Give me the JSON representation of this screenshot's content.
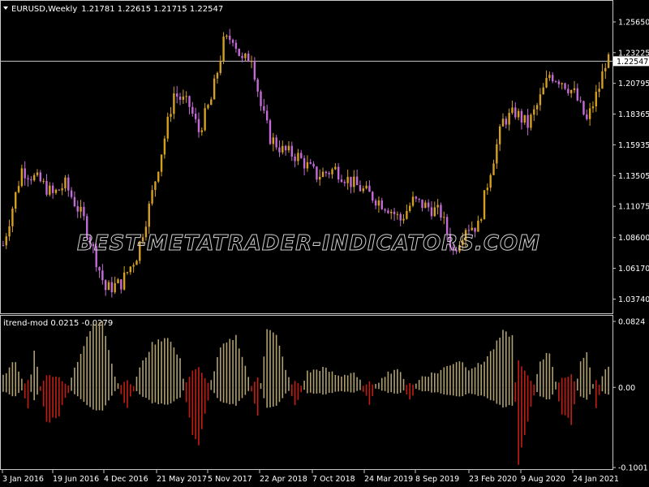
{
  "window": {
    "symbol": "EURUSD",
    "timeframe": "Weekly",
    "ohlc": "1.21781 1.22615 1.21715 1.22547",
    "collapse_icon": "triangle-down-icon"
  },
  "watermark": "BEST-METATRADER-INDICATORS.COM",
  "colors": {
    "background": "#000000",
    "bull": "#d4a020",
    "bear": "#c36bd6",
    "hist_pos": "#b0a070",
    "hist_neg": "#c41e14",
    "grid_line": "#c8c8c8",
    "price_tag_bg": "#ffffff",
    "price_tag_fg": "#000000"
  },
  "chart_data": [
    {
      "type": "candlestick",
      "title": "EURUSD,Weekly  1.21781 1.22615 1.21715 1.22547",
      "ylim": [
        1.03,
        1.27
      ],
      "yticks": [
        "1.25650",
        "1.23225",
        "1.20795",
        "1.18365",
        "1.15935",
        "1.13505",
        "1.11075",
        "1.08600",
        "1.06170",
        "1.03740"
      ],
      "current_price": "1.22547",
      "close_path": [
        [
          0,
          1.08
        ],
        [
          6,
          1.14
        ],
        [
          12,
          1.13
        ],
        [
          16,
          1.12
        ],
        [
          20,
          1.128
        ],
        [
          26,
          1.1
        ],
        [
          33,
          1.045
        ],
        [
          38,
          1.05
        ],
        [
          43,
          1.072
        ],
        [
          47,
          1.11
        ],
        [
          52,
          1.165
        ],
        [
          55,
          1.2
        ],
        [
          60,
          1.19
        ],
        [
          63,
          1.17
        ],
        [
          67,
          1.195
        ],
        [
          71,
          1.24
        ],
        [
          74,
          1.245
        ],
        [
          77,
          1.225
        ],
        [
          80,
          1.23
        ],
        [
          83,
          1.19
        ],
        [
          86,
          1.165
        ],
        [
          90,
          1.155
        ],
        [
          95,
          1.15
        ],
        [
          101,
          1.135
        ],
        [
          107,
          1.14
        ],
        [
          112,
          1.13
        ],
        [
          118,
          1.12
        ],
        [
          124,
          1.11
        ],
        [
          128,
          1.1
        ],
        [
          132,
          1.115
        ],
        [
          137,
          1.11
        ],
        [
          141,
          1.105
        ],
        [
          145,
          1.075
        ],
        [
          149,
          1.095
        ],
        [
          153,
          1.095
        ],
        [
          157,
          1.14
        ],
        [
          161,
          1.178
        ],
        [
          165,
          1.185
        ],
        [
          169,
          1.175
        ],
        [
          172,
          1.19
        ],
        [
          176,
          1.215
        ],
        [
          180,
          1.21
        ],
        [
          184,
          1.2
        ],
        [
          188,
          1.178
        ],
        [
          192,
          1.205
        ],
        [
          194,
          1.225
        ]
      ]
    },
    {
      "type": "bar",
      "title": "itrend-mod 0.0215 -0.0279",
      "ylim": [
        -0.1001,
        0.0824
      ],
      "yticks": [
        "0.0824",
        "0.00",
        "-0.1001"
      ],
      "series": [
        {
          "values_path": [
            [
              0,
              0.01
            ],
            [
              4,
              0.03
            ],
            [
              8,
              -0.02
            ],
            [
              10,
              0.04
            ],
            [
              14,
              -0.04
            ],
            [
              18,
              -0.03
            ],
            [
              24,
              0.03
            ],
            [
              29,
              0.075
            ],
            [
              32,
              0.08
            ],
            [
              36,
              0.01
            ],
            [
              40,
              -0.02
            ],
            [
              44,
              0.02
            ],
            [
              48,
              0.05
            ],
            [
              53,
              0.06
            ],
            [
              57,
              0.03
            ],
            [
              61,
              -0.055
            ],
            [
              63,
              -0.07
            ],
            [
              66,
              -0.01
            ],
            [
              70,
              0.045
            ],
            [
              75,
              0.06
            ],
            [
              79,
              0.01
            ],
            [
              82,
              -0.03
            ],
            [
              85,
              0.07
            ],
            [
              88,
              0.06
            ],
            [
              91,
              0.02
            ],
            [
              94,
              -0.02
            ],
            [
              98,
              0.015
            ],
            [
              103,
              0.02
            ],
            [
              108,
              0.01
            ],
            [
              113,
              0.015
            ],
            [
              118,
              -0.015
            ],
            [
              122,
              0.01
            ],
            [
              127,
              0.02
            ],
            [
              131,
              -0.01
            ],
            [
              135,
              0.01
            ],
            [
              140,
              0.015
            ],
            [
              144,
              0.025
            ],
            [
              147,
              0.03
            ],
            [
              150,
              0.02
            ],
            [
              154,
              0.025
            ],
            [
              158,
              0.045
            ],
            [
              161,
              0.065
            ],
            [
              164,
              0.06
            ],
            [
              166,
              -0.09
            ],
            [
              169,
              -0.04
            ],
            [
              173,
              0.03
            ],
            [
              176,
              0.04
            ],
            [
              180,
              -0.03
            ],
            [
              183,
              -0.04
            ],
            [
              186,
              0.03
            ],
            [
              188,
              0.04
            ],
            [
              191,
              -0.02
            ],
            [
              194,
              0.021
            ]
          ]
        }
      ]
    }
  ],
  "xaxis": {
    "labels": [
      "3 Jan 2016",
      "19 Jun 2016",
      "4 Dec 2016",
      "21 May 2017",
      "5 Nov 2017",
      "22 Apr 2018",
      "7 Oct 2018",
      "24 Mar 2019",
      "8 Sep 2019",
      "23 Feb 2020",
      "9 Aug 2020",
      "24 Jan 2021"
    ]
  }
}
